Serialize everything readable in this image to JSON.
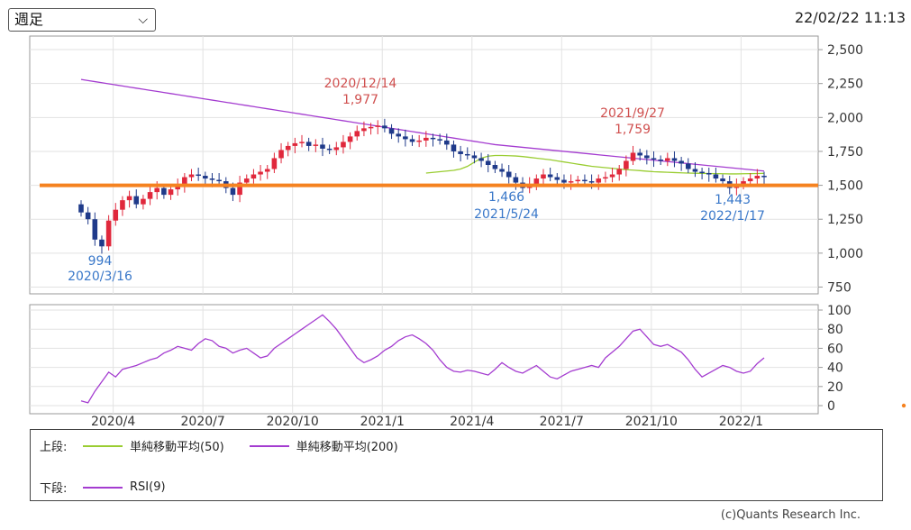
{
  "controls": {
    "period_select_value": "週足",
    "timestamp": "22/02/22 11:13"
  },
  "chart_data": {
    "type": "candlestick",
    "upper": {
      "ylim": [
        700,
        2600
      ],
      "yticks": [
        "2,500",
        "2,250",
        "2,000",
        "1,750",
        "1,500",
        "1,250",
        "1,000",
        "750"
      ],
      "ytick_values": [
        2500,
        2250,
        2000,
        1750,
        1500,
        1250,
        1000,
        750
      ],
      "horizontal_line": {
        "value": 1500,
        "color": "#f58220"
      },
      "closes": [
        1300,
        1250,
        1100,
        1050,
        1240,
        1320,
        1390,
        1420,
        1360,
        1400,
        1450,
        1480,
        1430,
        1470,
        1500,
        1560,
        1580,
        1570,
        1550,
        1540,
        1530,
        1480,
        1430,
        1520,
        1550,
        1580,
        1600,
        1620,
        1700,
        1760,
        1790,
        1810,
        1820,
        1790,
        1800,
        1770,
        1760,
        1780,
        1820,
        1860,
        1900,
        1920,
        1930,
        1940,
        1920,
        1880,
        1860,
        1840,
        1820,
        1830,
        1850,
        1840,
        1830,
        1800,
        1750,
        1730,
        1720,
        1700,
        1680,
        1650,
        1620,
        1600,
        1560,
        1520,
        1480,
        1510,
        1550,
        1580,
        1560,
        1540,
        1520,
        1530,
        1540,
        1530,
        1520,
        1550,
        1560,
        1580,
        1620,
        1680,
        1740,
        1720,
        1700,
        1690,
        1680,
        1700,
        1680,
        1660,
        1620,
        1600,
        1590,
        1580,
        1550,
        1530,
        1480,
        1500,
        1530,
        1550,
        1570,
        1560
      ],
      "sma50": [
        null,
        null,
        null,
        null,
        null,
        null,
        null,
        null,
        null,
        null,
        null,
        null,
        null,
        null,
        null,
        null,
        null,
        null,
        null,
        null,
        null,
        null,
        null,
        null,
        null,
        null,
        null,
        null,
        null,
        null,
        null,
        null,
        null,
        null,
        null,
        null,
        null,
        null,
        null,
        null,
        null,
        null,
        null,
        null,
        null,
        null,
        null,
        null,
        null,
        null,
        1590,
        1595,
        1600,
        1605,
        1610,
        1620,
        1640,
        1670,
        1700,
        1715,
        1720,
        1720,
        1718,
        1716,
        1712,
        1706,
        1700,
        1694,
        1688,
        1680,
        1672,
        1664,
        1656,
        1648,
        1640,
        1635,
        1630,
        1625,
        1620,
        1615,
        1612,
        1608,
        1604,
        1600,
        1598,
        1596,
        1594,
        1592,
        1590,
        1589,
        1588,
        1587,
        1586,
        1585,
        1584,
        1584,
        1585,
        1586,
        1587,
        1588
      ],
      "sma200": [
        2280,
        2272,
        2264,
        2256,
        2248,
        2240,
        2232,
        2224,
        2216,
        2208,
        2200,
        2192,
        2184,
        2176,
        2168,
        2160,
        2152,
        2144,
        2136,
        2128,
        2120,
        2112,
        2104,
        2096,
        2088,
        2080,
        2072,
        2064,
        2056,
        2048,
        2040,
        2032,
        2024,
        2016,
        2008,
        2000,
        1992,
        1984,
        1976,
        1968,
        1960,
        1952,
        1944,
        1936,
        1928,
        1920,
        1912,
        1904,
        1896,
        1888,
        1880,
        1872,
        1864,
        1856,
        1848,
        1840,
        1832,
        1824,
        1816,
        1808,
        1800,
        1795,
        1790,
        1785,
        1780,
        1775,
        1770,
        1765,
        1760,
        1755,
        1750,
        1745,
        1740,
        1735,
        1730,
        1725,
        1720,
        1715,
        1710,
        1705,
        1700,
        1695,
        1690,
        1685,
        1680,
        1675,
        1670,
        1665,
        1660,
        1655,
        1650,
        1645,
        1640,
        1635,
        1630,
        1625,
        1620,
        1615,
        1610,
        1605
      ],
      "annotations": [
        {
          "value": "994",
          "date": "2020/3/16",
          "color": "#3a78c9"
        },
        {
          "value": "1,977",
          "date": "2020/12/14",
          "color": "#d0504f"
        },
        {
          "value": "1,466",
          "date": "2021/5/24",
          "color": "#3a78c9"
        },
        {
          "value": "1,759",
          "date": "2021/9/27",
          "color": "#d0504f"
        },
        {
          "value": "1,443",
          "date": "2022/1/17",
          "color": "#3a78c9"
        }
      ]
    },
    "lower": {
      "ylim": [
        0,
        100
      ],
      "yticks": [
        "100",
        "80",
        "60",
        "40",
        "20",
        "0"
      ],
      "ytick_values": [
        100,
        80,
        60,
        40,
        20,
        0
      ],
      "rsi": [
        5,
        3,
        15,
        25,
        35,
        30,
        38,
        40,
        42,
        45,
        48,
        50,
        55,
        58,
        62,
        60,
        58,
        65,
        70,
        68,
        62,
        60,
        55,
        58,
        60,
        55,
        50,
        52,
        60,
        65,
        70,
        75,
        80,
        85,
        90,
        95,
        88,
        80,
        70,
        60,
        50,
        45,
        48,
        52,
        58,
        62,
        68,
        72,
        74,
        70,
        65,
        58,
        48,
        40,
        36,
        35,
        37,
        36,
        34,
        32,
        38,
        45,
        40,
        36,
        34,
        38,
        42,
        36,
        30,
        28,
        32,
        36,
        38,
        40,
        42,
        40,
        50,
        56,
        62,
        70,
        78,
        80,
        72,
        64,
        62,
        64,
        60,
        56,
        48,
        38,
        30,
        34,
        38,
        42,
        40,
        36,
        34,
        36,
        44,
        50
      ],
      "line_color": "#a43cd0"
    },
    "xticks": [
      "2020/4",
      "2020/7",
      "2020/10",
      "2021/1",
      "2021/4",
      "2021/7",
      "2021/10",
      "2022/1"
    ],
    "xtick_index": [
      4,
      17,
      30,
      43,
      56,
      69,
      82,
      95
    ],
    "colors": {
      "up": "#e0283c",
      "down": "#1f3a8a",
      "sma50": "#9acd32",
      "sma200": "#a43cd0"
    }
  },
  "legend": {
    "upper_label": "上段:",
    "lower_label": "下段:",
    "sma50_label": "単純移動平均(50)",
    "sma200_label": "単純移動平均(200)",
    "rsi_label": "RSI(9)"
  },
  "footer": {
    "copyright": "(c)Quants Research Inc."
  }
}
